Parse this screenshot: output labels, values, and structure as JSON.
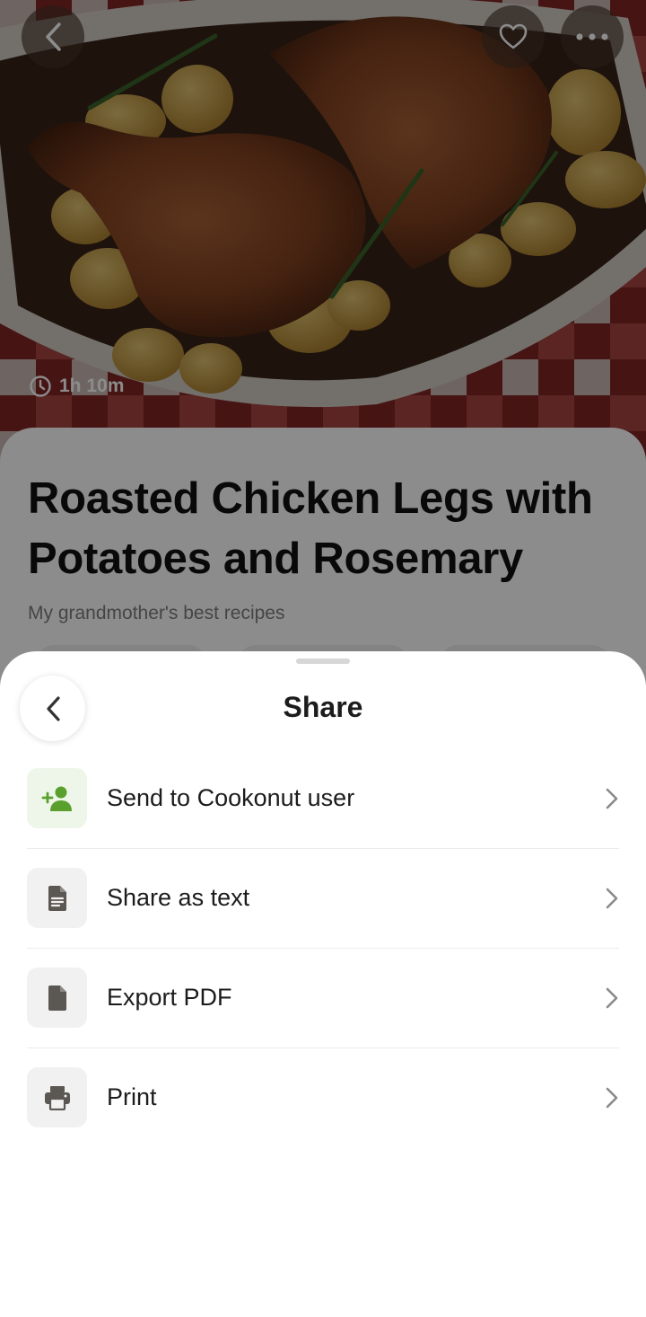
{
  "hero": {
    "cook_time": "1h 10m",
    "icons": {
      "back": "chevron-left-icon",
      "favorite": "heart-outline-icon",
      "more": "more-horizontal-icon",
      "clock": "clock-icon"
    }
  },
  "recipe": {
    "title": "Roasted Chicken Legs with Potatoes and Rosemary",
    "collection": "My grandmother's best recipes"
  },
  "share_sheet": {
    "title": "Share",
    "back_icon": "chevron-left-icon",
    "options": [
      {
        "label": "Send to Cookonut user",
        "icon": "add-person-icon",
        "accent": "#5aa02c"
      },
      {
        "label": "Share as text",
        "icon": "text-document-icon"
      },
      {
        "label": "Export PDF",
        "icon": "file-icon"
      },
      {
        "label": "Print",
        "icon": "printer-icon"
      }
    ]
  },
  "colors": {
    "accent_green": "#5aa02c",
    "icon_gray": "#5b5752",
    "sheet_background": "#ffffff"
  }
}
